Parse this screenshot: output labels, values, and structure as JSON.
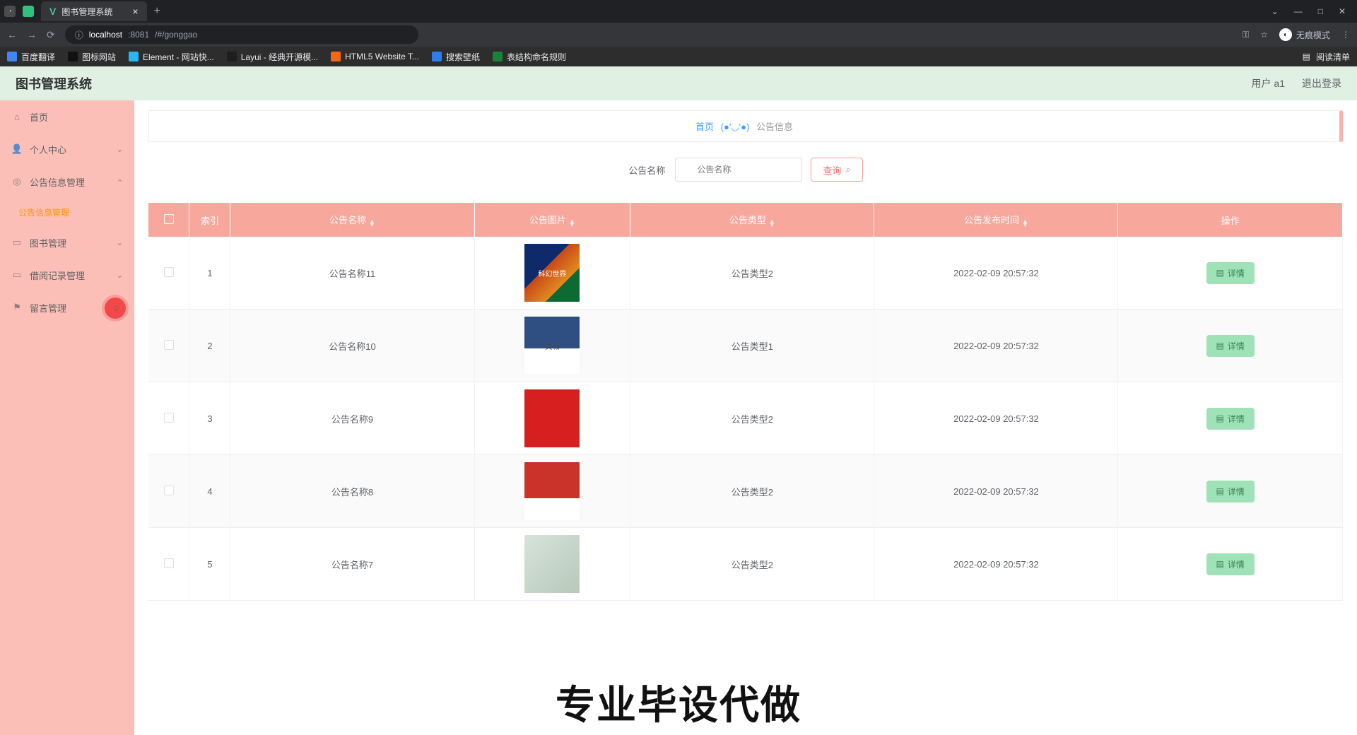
{
  "browser": {
    "tab_title": "图书管理系统",
    "url_host": "localhost",
    "url_port": ":8081",
    "url_path": "/#/gonggao",
    "incognito_label": "无痕模式",
    "reading_list": "阅读清单",
    "bookmarks": [
      {
        "label": "百度翻译",
        "favcls": "fav-blue"
      },
      {
        "label": "图标网站",
        "favcls": "fav-black"
      },
      {
        "label": "Element - 网站快...",
        "favcls": "fav-teal"
      },
      {
        "label": "Layui - 经典开源模...",
        "favcls": "fav-lay"
      },
      {
        "label": "HTML5 Website T...",
        "favcls": "fav-or"
      },
      {
        "label": "搜索壁纸",
        "favcls": "fav-u"
      },
      {
        "label": "表结构命名规则",
        "favcls": "fav-g"
      }
    ]
  },
  "header": {
    "app_title": "图书管理系统",
    "user_label": "用户 a1",
    "logout": "退出登录"
  },
  "sidebar": {
    "items": [
      {
        "icon": "⌂",
        "label": "首页",
        "chev": false
      },
      {
        "icon": "👤",
        "label": "个人中心",
        "chev": true
      },
      {
        "icon": "◎",
        "label": "公告信息管理",
        "chev": true,
        "expanded": true
      },
      {
        "icon": "▭",
        "label": "图书管理",
        "chev": true
      },
      {
        "icon": "▭",
        "label": "借阅记录管理",
        "chev": true
      },
      {
        "icon": "⚑",
        "label": "留言管理",
        "chev": false,
        "cursor": true
      }
    ],
    "sub_active": "公告信息管理"
  },
  "breadcrumb": {
    "home": "首页",
    "face": "(●'◡'●)",
    "current": "公告信息"
  },
  "search": {
    "label": "公告名称",
    "placeholder": "公告名称",
    "button": "查询"
  },
  "table": {
    "columns": {
      "index": "索引",
      "name": "公告名称",
      "image": "公告图片",
      "type": "公告类型",
      "time": "公告发布时间",
      "op": "操作"
    },
    "detail_btn": "详情",
    "rows": [
      {
        "idx": "1",
        "name": "公告名称11",
        "thumbcls": "t1",
        "thumb_text": "科幻世界",
        "type": "公告类型2",
        "time": "2022-02-09 20:57:32"
      },
      {
        "idx": "2",
        "name": "公告名称10",
        "thumbcls": "t2",
        "thumb_text": "文城",
        "type": "公告类型1",
        "time": "2022-02-09 20:57:32"
      },
      {
        "idx": "3",
        "name": "公告名称9",
        "thumbcls": "t3",
        "thumb_text": "",
        "type": "公告类型2",
        "time": "2022-02-09 20:57:32"
      },
      {
        "idx": "4",
        "name": "公告名称8",
        "thumbcls": "t4",
        "thumb_text": "",
        "type": "公告类型2",
        "time": "2022-02-09 20:57:32"
      },
      {
        "idx": "5",
        "name": "公告名称7",
        "thumbcls": "t5",
        "thumb_text": "",
        "type": "公告类型2",
        "time": "2022-02-09 20:57:32"
      }
    ]
  },
  "watermark": "专业毕设代做"
}
